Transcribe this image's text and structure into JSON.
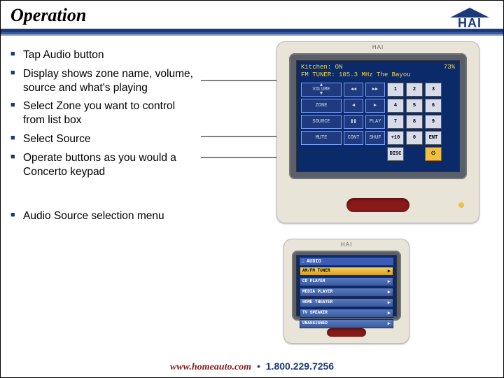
{
  "header": {
    "title": "Operation",
    "logo_text": "HAI"
  },
  "bullets": [
    "Tap Audio button",
    "Display shows zone name, volume, source and what's playing",
    "Select Zone you want to control from list box",
    "Select Source",
    "Operate buttons as you would a Concerto keypad"
  ],
  "bullet_sub": "Audio Source selection menu",
  "device_large": {
    "brand": "HAI",
    "status_zone": "Kitchen: ON",
    "status_vol": "73%",
    "status_src": "FM TUNER:  105.3 MHz The Bayou",
    "rows": [
      {
        "main": "▲\nVOLUME\n▼",
        "b1": "◀◀",
        "b2": "▶▶",
        "n1": "1",
        "n2": "2",
        "n3": "3"
      },
      {
        "main": "ZONE",
        "b1": "◀",
        "b2": "▶",
        "n1": "4",
        "n2": "5",
        "n3": "6"
      },
      {
        "main": "SOURCE",
        "b1": "❚❚",
        "b2": "PLAY",
        "n1": "7",
        "n2": "8",
        "n3": "9"
      },
      {
        "main": "MUTE",
        "b1": "CONT",
        "b2": "SHUF",
        "n1": "+10",
        "n2": "0",
        "n3": "ENT"
      },
      {
        "main": "",
        "b1": "",
        "b2": "",
        "n1": "DISC",
        "n2": "",
        "n3": ""
      }
    ]
  },
  "device_small": {
    "brand": "HAI",
    "menu_title": "AUDIO",
    "items": [
      {
        "label": "AM/FM TUNER",
        "selected": true
      },
      {
        "label": "CD PLAYER",
        "selected": false
      },
      {
        "label": "MEDIA PLAYER",
        "selected": false
      },
      {
        "label": "HOME THEATER",
        "selected": false
      },
      {
        "label": "TV SPEAKER",
        "selected": false
      },
      {
        "label": "UNASSIGNED",
        "selected": false
      }
    ]
  },
  "footer": {
    "url": "www.homeauto.com",
    "tel": "1.800.229.7256"
  }
}
